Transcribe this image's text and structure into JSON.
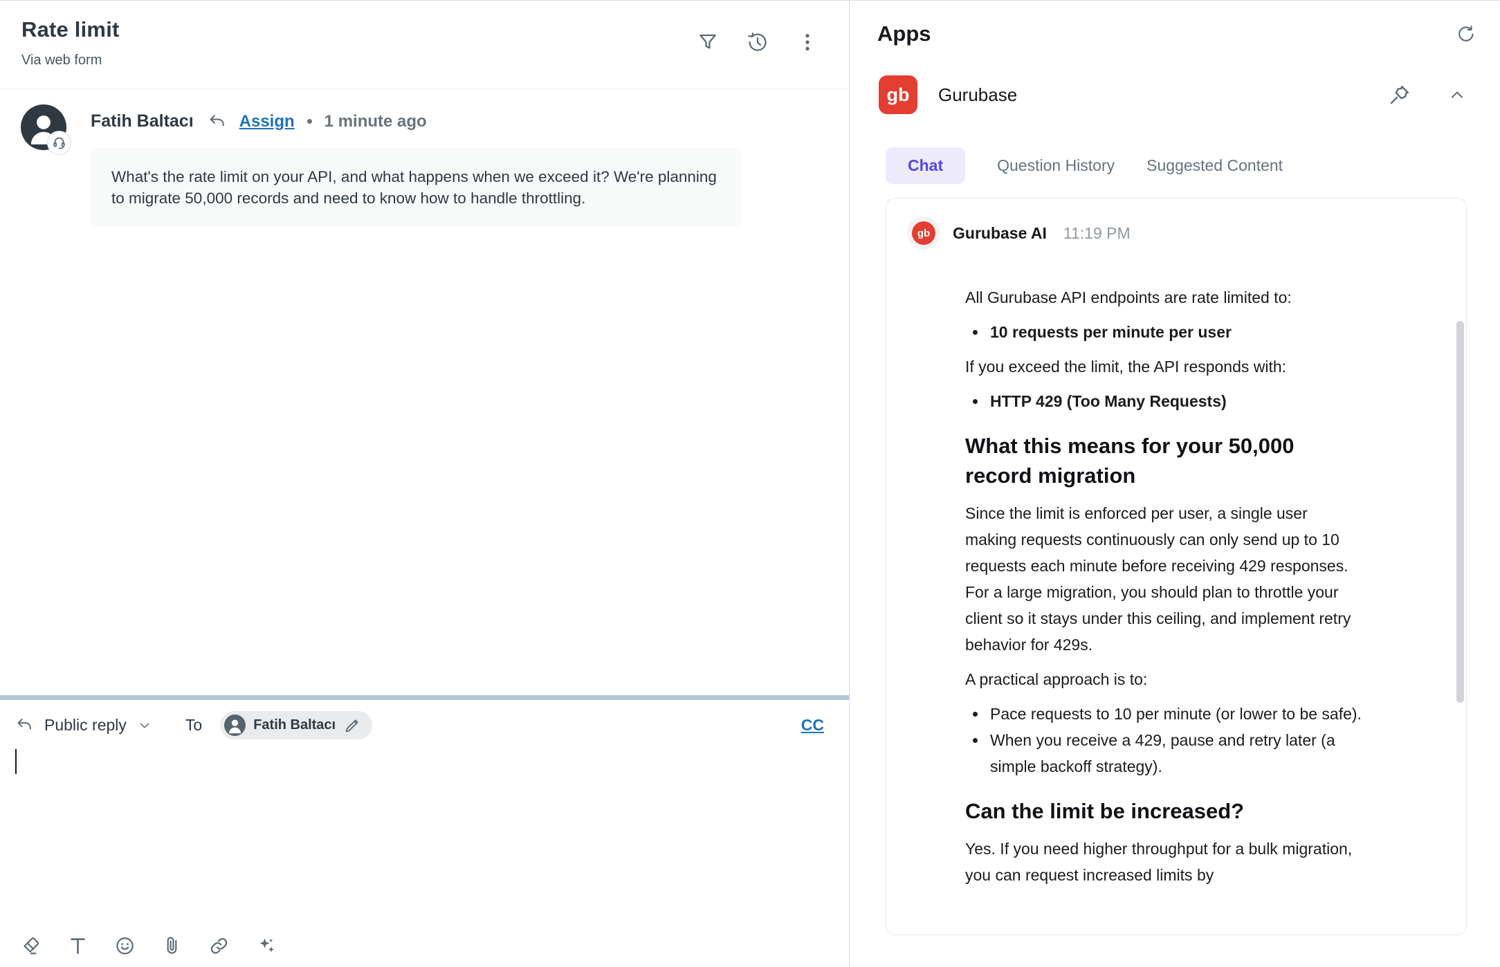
{
  "ticket": {
    "title": "Rate limit",
    "channel": "Via web form",
    "header_icons": [
      "filter-icon",
      "history-icon",
      "overflow-menu-icon"
    ],
    "message": {
      "author": "Fatih Baltacı",
      "assign_label": "Assign",
      "timestamp": "1 minute ago",
      "body": "What's the rate limit on your API, and what happens when we exceed it? We're planning to migrate 50,000 records and need to know how to handle throttling."
    },
    "composer": {
      "reply_type": "Public reply",
      "to_label": "To",
      "recipient": "Fatih Baltacı",
      "cc_label": "CC",
      "toolbar_icons": [
        "eraser-icon",
        "text-format-icon",
        "emoji-icon",
        "attachment-icon",
        "link-icon",
        "sparkles-icon"
      ]
    }
  },
  "apps_panel": {
    "title": "Apps",
    "app": {
      "logo_text": "gb",
      "name": "Gurubase"
    },
    "tabs": [
      {
        "label": "Chat",
        "active": true
      },
      {
        "label": "Question History",
        "active": false
      },
      {
        "label": "Suggested Content",
        "active": false
      }
    ],
    "chat": {
      "avatar_text": "gb",
      "sender": "Gurubase AI",
      "time": "11:19 PM",
      "blocks": [
        {
          "type": "p",
          "text": "All Gurubase API endpoints are rate limited to:"
        },
        {
          "type": "ul",
          "items": [
            {
              "text": "10 requests per minute per user",
              "bold": true
            }
          ]
        },
        {
          "type": "p",
          "text": "If you exceed the limit, the API responds with:"
        },
        {
          "type": "ul",
          "items": [
            {
              "text": "HTTP 429 (Too Many Requests)",
              "bold": true
            }
          ]
        },
        {
          "type": "h3",
          "text": "What this means for your 50,000 record migration"
        },
        {
          "type": "p",
          "text": "Since the limit is enforced per user, a single user making requests continuously can only send up to 10 requests each minute before receiving 429 responses. For a large migration, you should plan to throttle your client so it stays under this ceiling, and implement retry behavior for 429s."
        },
        {
          "type": "p",
          "text": "A practical approach is to:"
        },
        {
          "type": "ul",
          "items": [
            {
              "text": "Pace requests to 10 per minute (or lower to be safe).",
              "bold": false
            },
            {
              "text": "When you receive a 429, pause and retry later (a simple backoff strategy).",
              "bold": false
            }
          ]
        },
        {
          "type": "h3",
          "text": "Can the limit be increased?"
        },
        {
          "type": "p",
          "text": "Yes. If you need higher throughput for a bulk migration, you can request increased limits by"
        }
      ]
    }
  },
  "colors": {
    "accent_blue": "#1f73b7",
    "brand_red": "#e33e31",
    "tab_active_text": "#5746e5",
    "tab_active_bg": "#eceafb",
    "composer_focus_bar": "#b6c6d9",
    "avatar_bg": "#2f3941"
  }
}
